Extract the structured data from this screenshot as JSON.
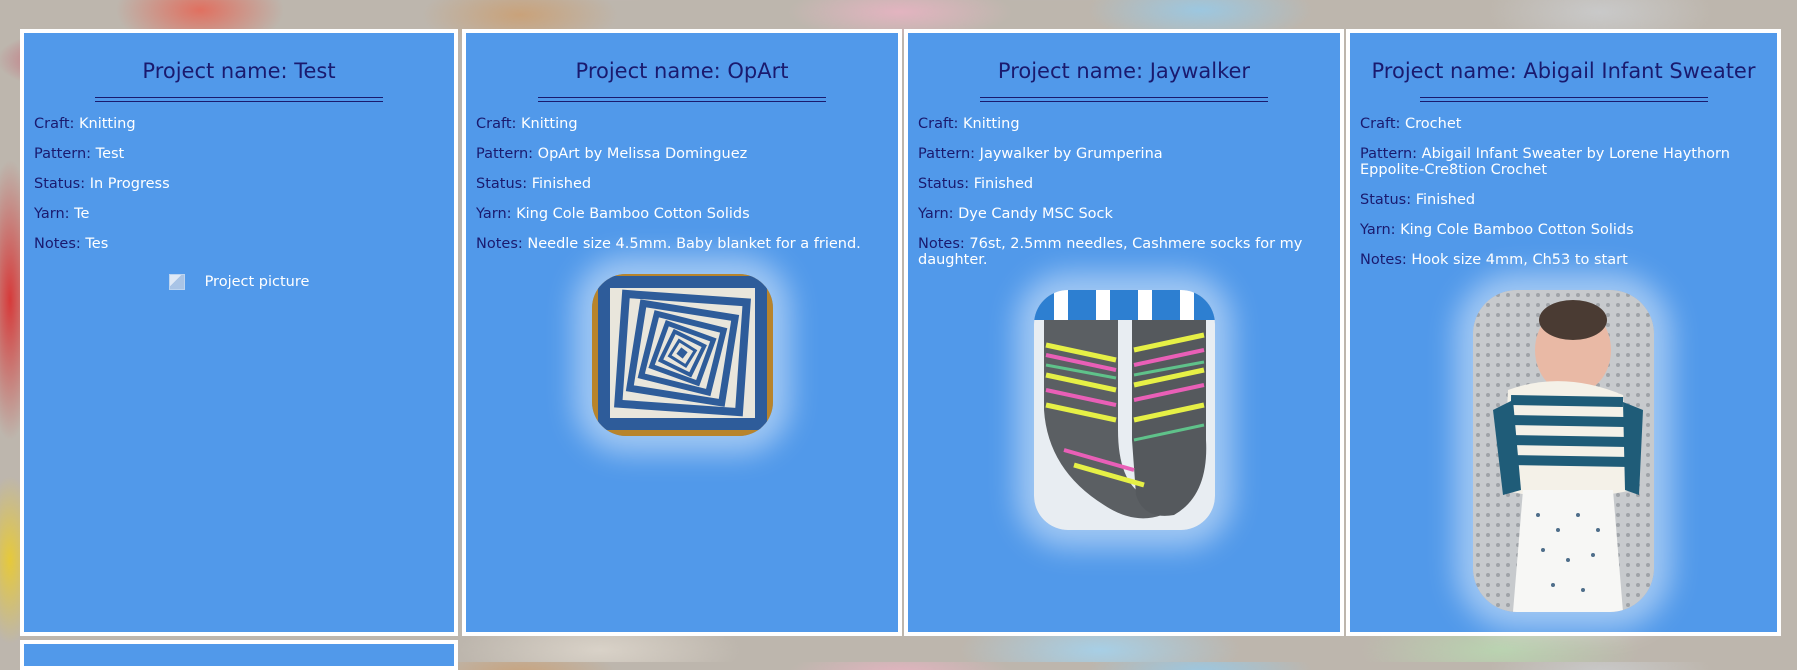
{
  "labels": {
    "craft": "Craft:",
    "pattern": "Pattern:",
    "status": "Status:",
    "yarn": "Yarn:",
    "notes": "Notes:"
  },
  "projects": [
    {
      "title": "Project name: Test",
      "craft": "Knitting",
      "pattern": "Test",
      "status": "In Progress",
      "yarn": "Te",
      "notes": "Tes",
      "picture_alt": "Project picture"
    },
    {
      "title": "Project name: OpArt",
      "craft": "Knitting",
      "pattern": "OpArt by Melissa Dominguez",
      "status": "Finished",
      "yarn": "King Cole Bamboo Cotton Solids",
      "notes": "Needle size 4.5mm. Baby blanket for a friend."
    },
    {
      "title": "Project name: Jaywalker",
      "craft": "Knitting",
      "pattern": "Jaywalker by Grumperina",
      "status": "Finished",
      "yarn": "Dye Candy MSC Sock",
      "notes": "76st, 2.5mm needles, Cashmere socks for my daughter."
    },
    {
      "title": "Project name: Abigail Infant Sweater",
      "craft": "Crochet",
      "pattern": "Abigail Infant Sweater by Lorene Haythorn Eppolite-Cre8tion Crochet",
      "status": "Finished",
      "yarn": "King Cole Bamboo Cotton Solids",
      "notes": "Hook size 4mm, Ch53 to start"
    }
  ],
  "colors": {
    "panel": "#5199ea",
    "label": "#1a1a6e",
    "value": "#ffffff",
    "border": "#ffffff"
  }
}
